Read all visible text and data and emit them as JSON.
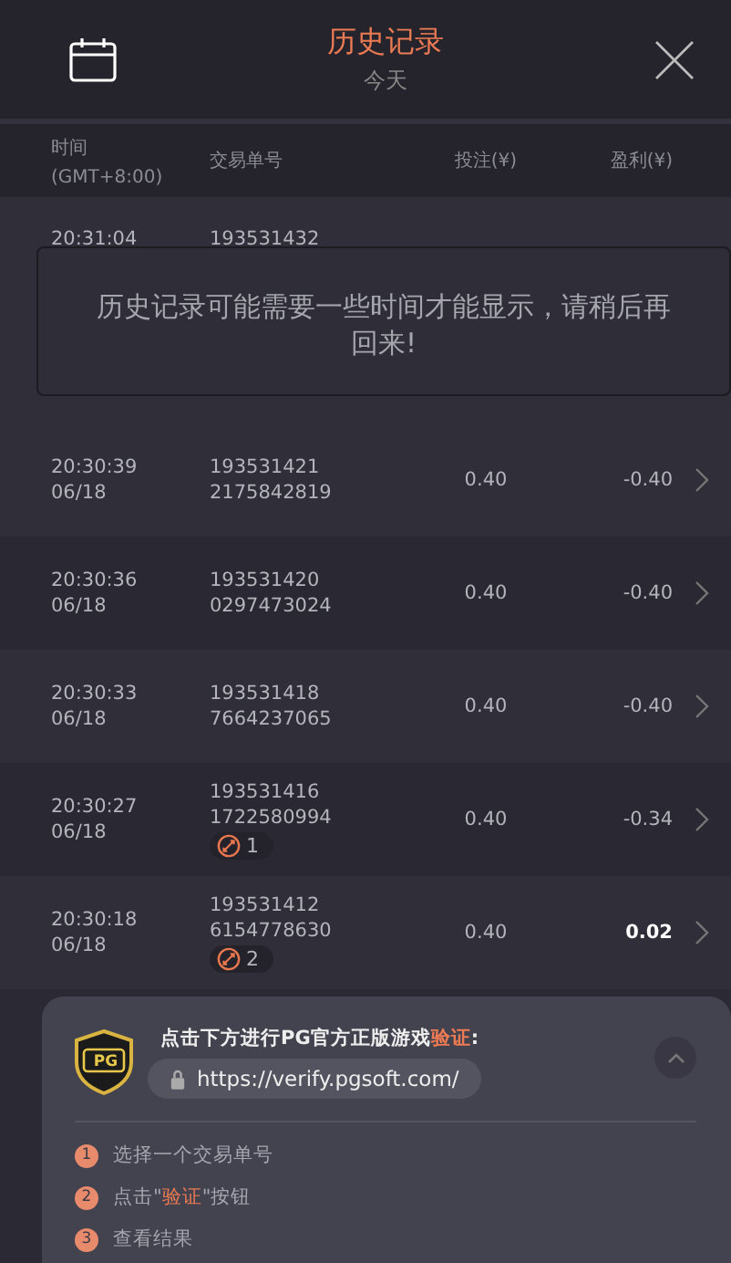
{
  "header": {
    "title": "历史记录",
    "subtitle": "今天"
  },
  "columns": [
    {
      "label": "时间",
      "sublabel": "(GMT+8:00)"
    },
    {
      "label": "交易单号"
    },
    {
      "label": "投注(¥)"
    },
    {
      "label": "盈利(¥)"
    }
  ],
  "first_row": {
    "time": "20:31:04",
    "order": "193531432"
  },
  "toast": "历史记录可能需要一些时间才能显示，请稍后再回来!",
  "rows": [
    {
      "time": "20:30:39",
      "date": "06/18",
      "order_1": "193531421",
      "order_2": "2175842819",
      "bet": "0.40",
      "profit": "-0.40",
      "highlighted": false
    },
    {
      "time": "20:30:36",
      "date": "06/18",
      "order_1": "193531420",
      "order_2": "0297473024",
      "bet": "0.40",
      "profit": "-0.40",
      "highlighted": false
    },
    {
      "time": "20:30:33",
      "date": "06/18",
      "order_1": "193531418",
      "order_2": "7664237065",
      "bet": "0.40",
      "profit": "-0.40",
      "highlighted": false
    },
    {
      "time": "20:30:27",
      "date": "06/18",
      "order_1": "193531416",
      "order_2": "1722580994",
      "free_spins": "1",
      "bet": "0.40",
      "profit": "-0.34",
      "highlighted": false
    },
    {
      "time": "20:30:18",
      "date": "06/18",
      "order_1": "193531412",
      "order_2": "6154778630",
      "free_spins": "2",
      "bet": "0.40",
      "profit": "0.02",
      "highlighted": true
    }
  ],
  "verify": {
    "logo_text": "PG",
    "title": "点击下方进行PG官方正版游戏",
    "title_highlight": "验证",
    "title_suffix": ":",
    "url": "https://verify.pgsoft.com/",
    "expanded": true,
    "steps": [
      {
        "number": "1",
        "text": "选择一个交易单号"
      },
      {
        "number": "2",
        "text": "点击\"",
        "highlight": "验证",
        "suffix": "\"按钮"
      },
      {
        "number": "3",
        "text": "查看结果"
      }
    ]
  }
}
